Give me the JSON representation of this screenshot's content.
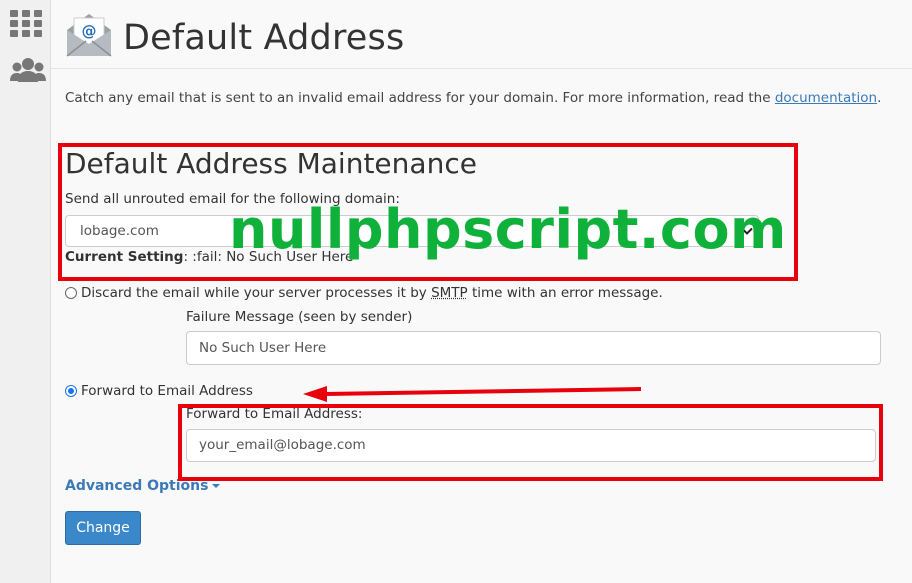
{
  "page": {
    "title": "Default Address",
    "description_prefix": "Catch any email that is sent to an invalid email address for your domain. For more information, read the ",
    "doc_link": "documentation",
    "description_suffix": "."
  },
  "sidebar": {
    "items": [
      {
        "icon": "grid-icon"
      },
      {
        "icon": "users-icon"
      }
    ]
  },
  "maintenance": {
    "title": "Default Address Maintenance",
    "domain_label": "Send all unrouted email for the following domain:",
    "domain_value": "lobage.com",
    "current_setting_label": "Current Setting",
    "current_setting_value": ": :fail: No Such User Here"
  },
  "options": {
    "discard": {
      "label_before": "Discard the email while your server processes it by ",
      "smtp": "SMTP",
      "label_after": " time with an error message.",
      "checked": false,
      "failure_label": "Failure Message (seen by sender)",
      "failure_value": "No Such User Here"
    },
    "forward": {
      "label": "Forward to Email Address",
      "checked": true,
      "field_label": "Forward to Email Address:",
      "field_value": "your_email@lobage.com"
    }
  },
  "advanced_options": "Advanced Options",
  "change_button": "Change",
  "watermark": "nullphpscript.com",
  "colors": {
    "accent": "#3a7ab8",
    "button": "#3a87c9",
    "highlight": "#e8000d",
    "watermark": "#0fb13a"
  }
}
